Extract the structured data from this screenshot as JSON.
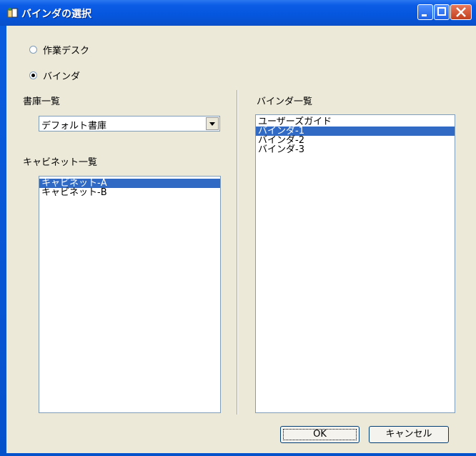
{
  "window": {
    "title": "バインダの選択"
  },
  "radios": [
    {
      "label": "作業デスク",
      "checked": false
    },
    {
      "label": "バインダ",
      "checked": true
    }
  ],
  "library": {
    "label": "書庫一覧",
    "selected": "デフォルト書庫"
  },
  "cabinets": {
    "label": "キャビネット一覧",
    "items": [
      "キャビネット-A",
      "キャビネット-B"
    ],
    "selected_index": 0
  },
  "binders": {
    "label": "バインダ一覧",
    "items": [
      "ユーザーズガイド",
      "バインダ-1",
      "バインダ-2",
      "バインダ-3"
    ],
    "selected_index": 1
  },
  "buttons": {
    "ok": "OK",
    "cancel": "キャンセル"
  },
  "colors": {
    "titlebar": "#0c5ce6",
    "selection": "#316ac5",
    "face": "#ece9d8"
  }
}
